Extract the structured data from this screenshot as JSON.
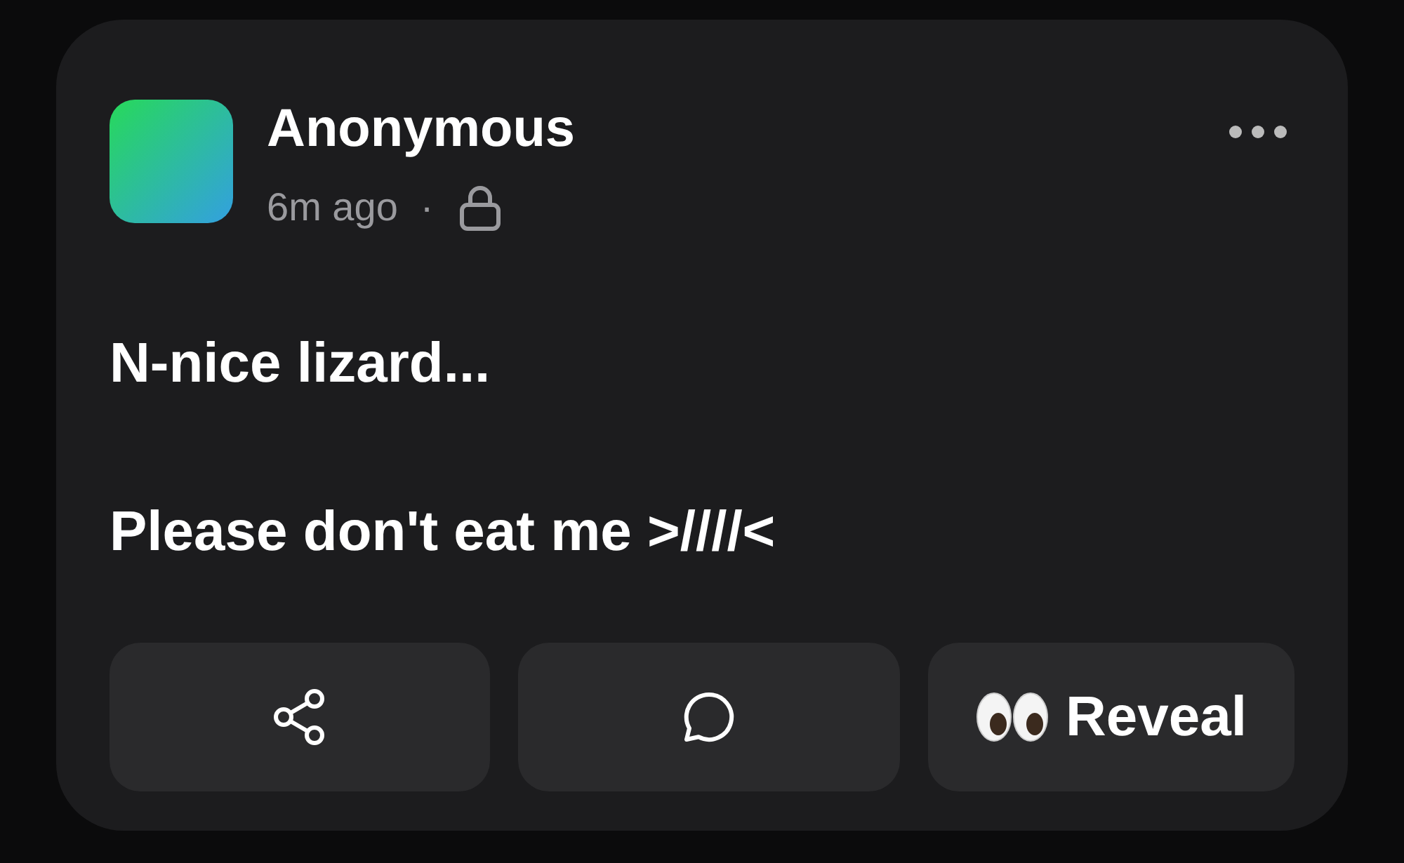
{
  "post": {
    "author": "Anonymous",
    "time": "6m ago",
    "separator": "·",
    "paragraphs": [
      "N-nice lizard...",
      "Please don't eat me >////<"
    ],
    "actions": [
      {
        "kind": "share"
      },
      {
        "kind": "comment"
      },
      {
        "kind": "reveal",
        "label": "Reveal"
      }
    ]
  }
}
